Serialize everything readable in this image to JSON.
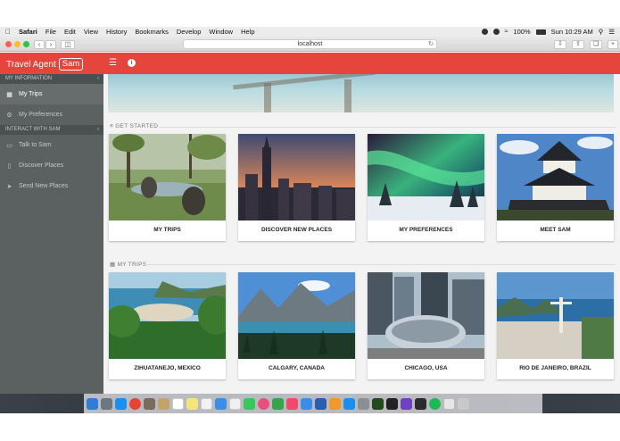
{
  "menubar": {
    "app_name": "Safari",
    "items": [
      "File",
      "Edit",
      "View",
      "History",
      "Bookmarks",
      "Develop",
      "Window",
      "Help"
    ],
    "battery": "100%",
    "clock": "Sun 10:29 AM"
  },
  "browser": {
    "url": "localhost"
  },
  "app": {
    "brand_text": "Travel Agent",
    "brand_badge": "Sam"
  },
  "sidebar": {
    "section_info": "MY INFORMATION",
    "section_interact": "INTERACT WITH SAM",
    "items": [
      {
        "label": "My Trips",
        "icon": "grid-icon"
      },
      {
        "label": "My Preferences",
        "icon": "gear-icon"
      },
      {
        "label": "Talk to Sam",
        "icon": "chat-icon"
      },
      {
        "label": "Discover Places",
        "icon": "map-icon"
      },
      {
        "label": "Send New Places",
        "icon": "send-icon"
      }
    ]
  },
  "main": {
    "get_started_title": "GET STARTED",
    "my_trips_title": "MY TRIPS",
    "get_started_cards": [
      {
        "label": "MY TRIPS"
      },
      {
        "label": "DISCOVER NEW PLACES"
      },
      {
        "label": "MY PREFERENCES"
      },
      {
        "label": "MEET SAM"
      }
    ],
    "trip_cards": [
      {
        "label": "ZIHUATANEJO, MEXICO"
      },
      {
        "label": "CALGARY, CANADA"
      },
      {
        "label": "CHICAGO, USA"
      },
      {
        "label": "RIO DE JANEIRO, BRAZIL"
      }
    ]
  },
  "colors": {
    "header_red": "#e5453d",
    "sidebar_bg": "#5b6061",
    "content_bg": "#f3f3f3"
  }
}
